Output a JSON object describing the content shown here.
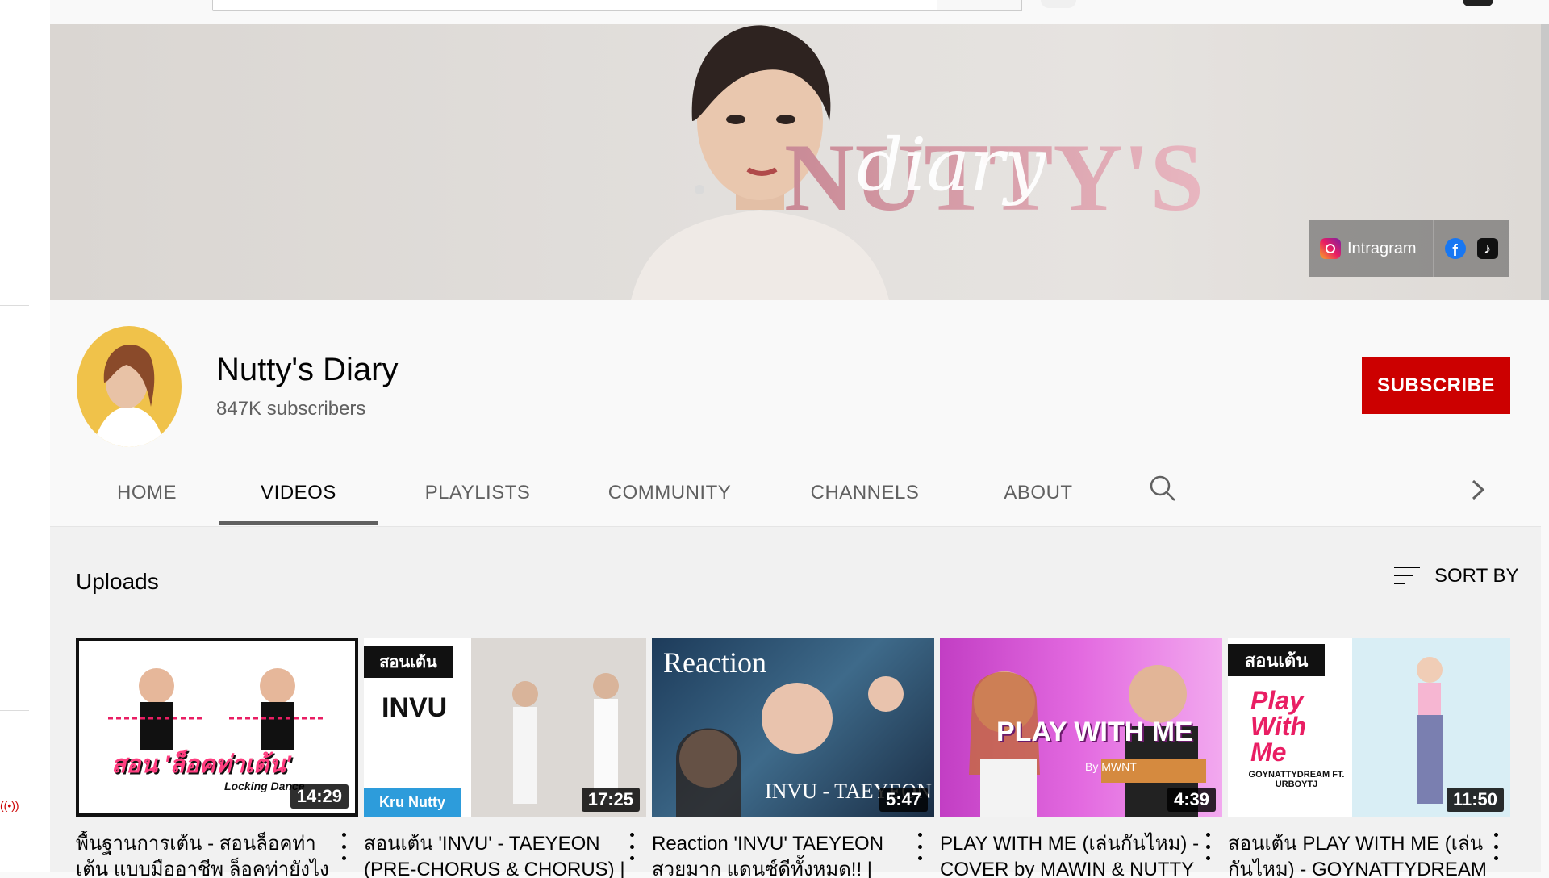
{
  "masthead": {
    "search_placeholder": ""
  },
  "banner": {
    "logo_main": "NUTTY'S",
    "logo_script": "diary",
    "links": [
      {
        "label": "Intragram",
        "icon": "instagram-icon"
      },
      {
        "icon": "facebook-icon"
      },
      {
        "icon": "tiktok-icon"
      }
    ]
  },
  "channel": {
    "name": "Nutty's Diary",
    "subscribers": "847K subscribers",
    "subscribe_label": "SUBSCRIBE"
  },
  "tabs": [
    {
      "label": "HOME"
    },
    {
      "label": "VIDEOS",
      "active": true
    },
    {
      "label": "PLAYLISTS"
    },
    {
      "label": "COMMUNITY"
    },
    {
      "label": "CHANNELS"
    },
    {
      "label": "ABOUT"
    }
  ],
  "uploads": {
    "title": "Uploads",
    "sort_label": "SORT BY"
  },
  "videos": [
    {
      "title": "พื้นฐานการเต้น - สอนล็อคท่าเต้น แบบมืออาชีพ ล็อคท่ายังไงให้ปัง",
      "duration": "14:29",
      "thumb_caption": "สอน 'ล็อคท่าเต้น'",
      "thumb_sub": "Locking Dance"
    },
    {
      "title": "สอนเต้น 'INVU' - TAEYEON (PRE-CHORUS & CHORUS) | Kru Nutty",
      "duration": "17:25",
      "thumb_caption": "INVU",
      "thumb_sub": "Kru Nutty",
      "thumb_tag": "สอนเต้น"
    },
    {
      "title": "Reaction 'INVU' TAEYEON สวยมาก แดนซ์ดีทั้งหมด!! | Nutty",
      "duration": "5:47",
      "thumb_caption": "Reaction",
      "thumb_sub": "INVU - TAEYEON"
    },
    {
      "title": "PLAY WITH ME (เล่นกันไหม) - COVER by MAWIN & NUTTY",
      "duration": "4:39",
      "thumb_caption": "PLAY WITH ME",
      "thumb_sub": "By MWNT"
    },
    {
      "title": "สอนเต้น PLAY WITH ME (เล่นกันไหม) - GOYNATTYDREAM",
      "duration": "11:50",
      "thumb_caption": "Play With Me",
      "thumb_sub": "GOYNATTYDREAM FT. URBOYTJ",
      "thumb_tag": "สอนเต้น"
    }
  ],
  "colors": {
    "brand_red": "#cc0000",
    "text_primary": "#030303",
    "text_secondary": "#606060"
  }
}
